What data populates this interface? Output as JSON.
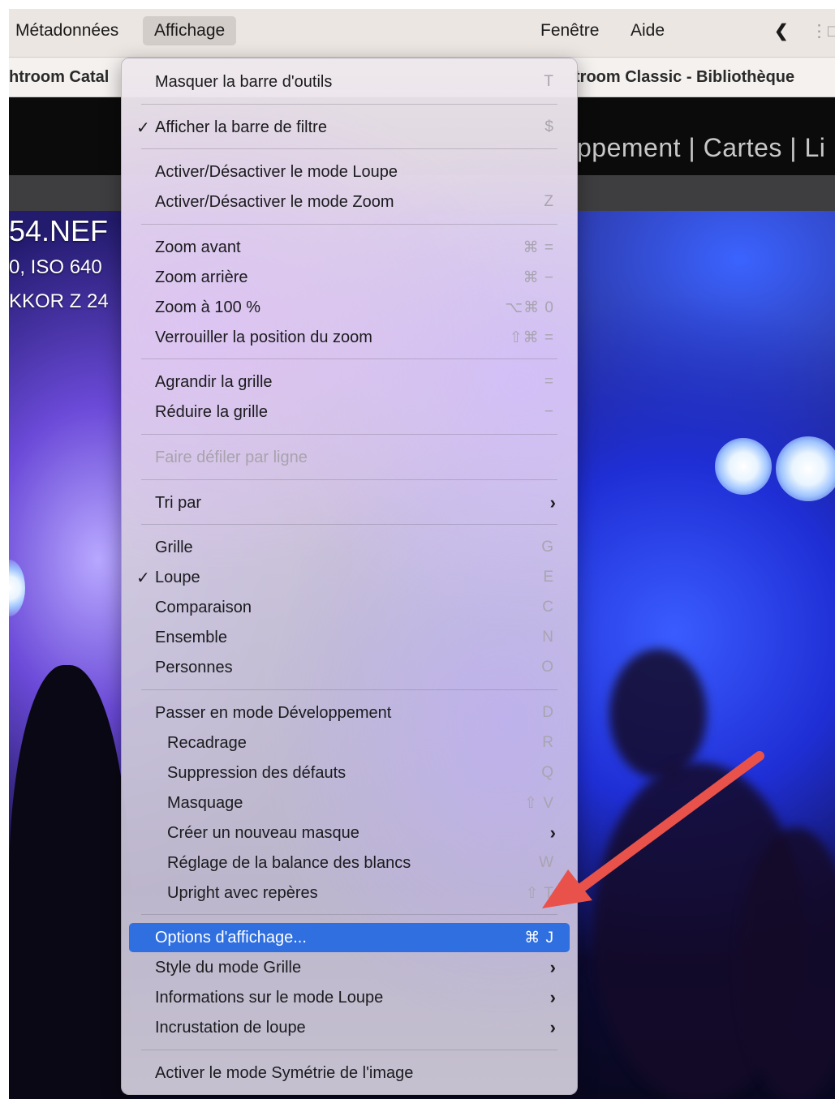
{
  "menubar": {
    "items": [
      "Métadonnées",
      "Affichage",
      "Fenêtre",
      "Aide"
    ],
    "back_glyph": "❮",
    "window_glyph": "⋮□"
  },
  "titlebar": {
    "left_title": "htroom Catal",
    "right_title": "troom Classic - Bibliothèque"
  },
  "modules": {
    "visible": "ppement | Cartes | Li"
  },
  "photo": {
    "filename": "54.NEF",
    "exposure": "0, ISO 640",
    "lens": "KKOR Z 24"
  },
  "menu": {
    "items": [
      {
        "label": "Masquer la barre d'outils",
        "shortcut": "T"
      },
      {
        "label": "Afficher la barre de filtre",
        "shortcut": "$",
        "checked": true
      },
      {
        "label": "Activer/Désactiver le mode Loupe",
        "shortcut": ""
      },
      {
        "label": "Activer/Désactiver le mode Zoom",
        "shortcut": "Z"
      },
      {
        "label": "Zoom avant",
        "shortcut": "⌘ ="
      },
      {
        "label": "Zoom arrière",
        "shortcut": "⌘ −"
      },
      {
        "label": "Zoom à 100 %",
        "shortcut": "⌥⌘ 0"
      },
      {
        "label": "Verrouiller la position du zoom",
        "shortcut": "⇧⌘ ="
      },
      {
        "label": "Agrandir la grille",
        "shortcut": "="
      },
      {
        "label": "Réduire la grille",
        "shortcut": "−"
      },
      {
        "label": "Faire défiler par ligne",
        "shortcut": "",
        "disabled": true
      },
      {
        "label": "Tri par",
        "submenu": true
      },
      {
        "label": "Grille",
        "shortcut": "G"
      },
      {
        "label": "Loupe",
        "shortcut": "E",
        "checked": true
      },
      {
        "label": "Comparaison",
        "shortcut": "C"
      },
      {
        "label": "Ensemble",
        "shortcut": "N"
      },
      {
        "label": "Personnes",
        "shortcut": "O"
      },
      {
        "label": "Passer en mode Développement",
        "shortcut": "D"
      },
      {
        "label": "Recadrage",
        "shortcut": "R"
      },
      {
        "label": "Suppression des défauts",
        "shortcut": "Q"
      },
      {
        "label": "Masquage",
        "shortcut": "⇧ V"
      },
      {
        "label": "Créer un nouveau masque",
        "submenu": true
      },
      {
        "label": "Réglage de la balance des blancs",
        "shortcut": "W"
      },
      {
        "label": "Upright avec repères",
        "shortcut": "⇧ T"
      },
      {
        "label": "Options d'affichage...",
        "shortcut": "⌘ J",
        "highlighted": true
      },
      {
        "label": "Style du mode Grille",
        "submenu": true
      },
      {
        "label": "Informations sur le mode Loupe",
        "submenu": true
      },
      {
        "label": "Incrustation de loupe",
        "submenu": true
      },
      {
        "label": "Activer le mode Symétrie de l'image",
        "shortcut": ""
      }
    ],
    "check_glyph": "✓",
    "submenu_glyph": "›"
  },
  "colors": {
    "highlight": "#2f6fe0",
    "annotation_arrow": "#e8524a"
  }
}
